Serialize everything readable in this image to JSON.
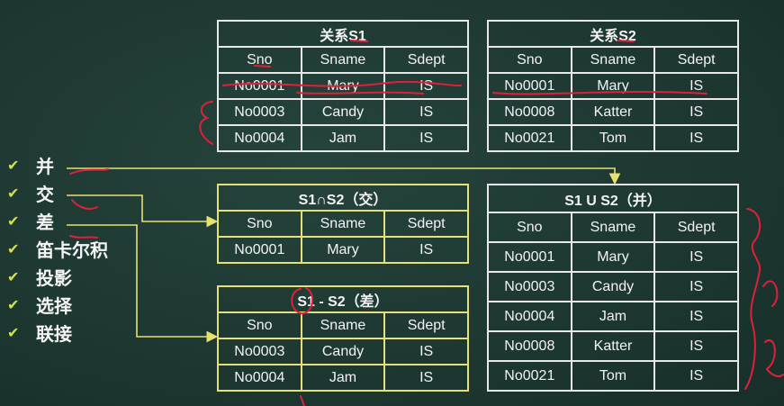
{
  "columns": [
    "Sno",
    "Sname",
    "Sdept"
  ],
  "s1": {
    "title": "关系S1",
    "rows": [
      [
        "No0001",
        "Mary",
        "IS"
      ],
      [
        "No0003",
        "Candy",
        "IS"
      ],
      [
        "No0004",
        "Jam",
        "IS"
      ]
    ]
  },
  "s2": {
    "title": "关系S2",
    "rows": [
      [
        "No0001",
        "Mary",
        "IS"
      ],
      [
        "No0008",
        "Katter",
        "IS"
      ],
      [
        "No0021",
        "Tom",
        "IS"
      ]
    ]
  },
  "intersection": {
    "title": "S1∩S2（交）",
    "rows": [
      [
        "No0001",
        "Mary",
        "IS"
      ]
    ]
  },
  "difference": {
    "title": "S1 - S2（差）",
    "rows": [
      [
        "No0003",
        "Candy",
        "IS"
      ],
      [
        "No0004",
        "Jam",
        "IS"
      ]
    ]
  },
  "union": {
    "title": "S1 U S2（并）",
    "rows": [
      [
        "No0001",
        "Mary",
        "IS"
      ],
      [
        "No0003",
        "Candy",
        "IS"
      ],
      [
        "No0004",
        "Jam",
        "IS"
      ],
      [
        "No0008",
        "Katter",
        "IS"
      ],
      [
        "No0021",
        "Tom",
        "IS"
      ]
    ]
  },
  "operations": [
    "并",
    "交",
    "差",
    "笛卡尔积",
    "投影",
    "选择",
    "联接"
  ],
  "check_glyph": "✔",
  "colors": {
    "background": "#1f3a33",
    "yellow_border": "#e6e07a",
    "white_border": "#e8e8e8",
    "annotation_red": "#e0203a",
    "arrow_yellow": "#e8e070",
    "check_yellow": "#d8e04a"
  }
}
